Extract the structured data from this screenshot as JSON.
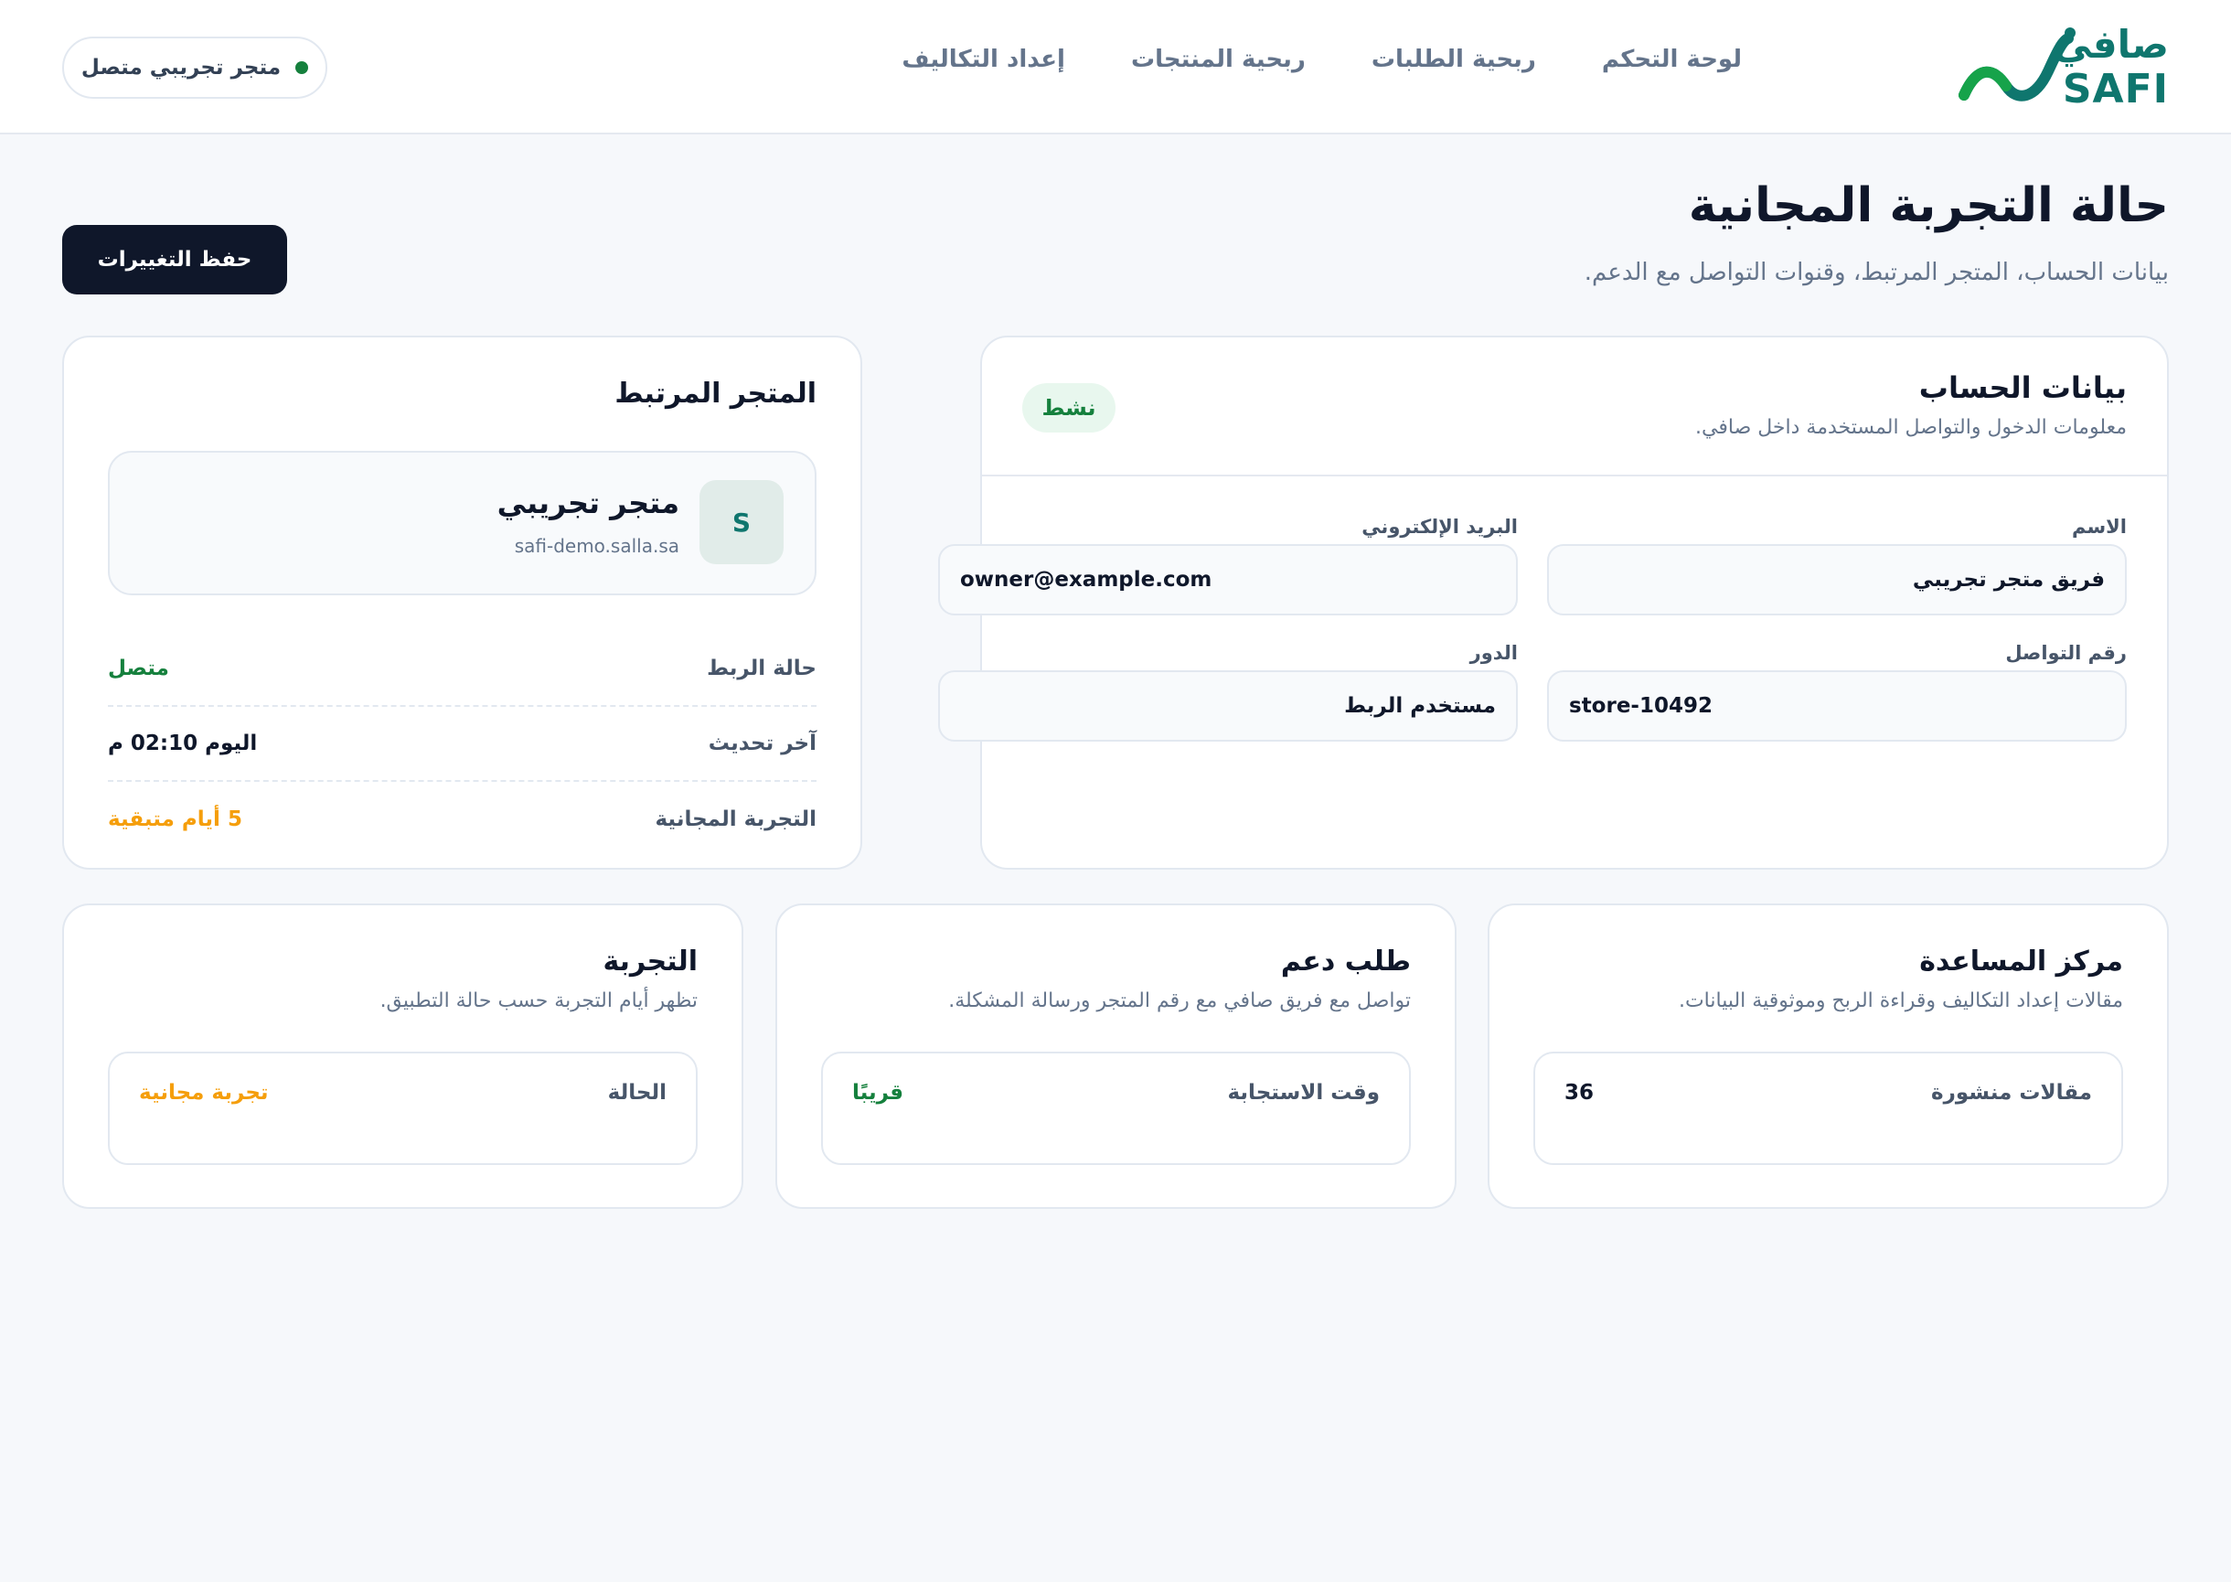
{
  "brand": {
    "name_ar": "صافي",
    "name_en": "SAFI"
  },
  "nav": {
    "items": [
      {
        "label": "لوحة التحكم"
      },
      {
        "label": "ربحية الطلبات"
      },
      {
        "label": "ربحية المنتجات"
      },
      {
        "label": "إعداد التكاليف"
      }
    ]
  },
  "store_status": {
    "label": "متجر تجريبي متصل"
  },
  "page": {
    "title": "حالة التجربة المجانية",
    "subtitle": "بيانات الحساب، المتجر المرتبط، وقنوات التواصل مع الدعم.",
    "save_label": "حفظ التغييرات"
  },
  "account": {
    "title": "بيانات الحساب",
    "description": "معلومات الدخول والتواصل المستخدمة داخل صافي.",
    "badge": "نشط",
    "fields": {
      "name": {
        "label": "الاسم",
        "value": "فريق متجر تجريبي"
      },
      "email": {
        "label": "البريد الإلكتروني",
        "value": "owner@example.com"
      },
      "phone": {
        "label": "رقم التواصل",
        "value": "store-10492"
      },
      "role": {
        "label": "الدور",
        "value": "مستخدم الربط"
      }
    }
  },
  "linked_store": {
    "title": "المتجر المرتبط",
    "avatar": "S",
    "name": "متجر تجريبي",
    "url": "safi-demo.salla.sa",
    "rows": [
      {
        "key": "حالة الربط",
        "value": "متصل"
      },
      {
        "key": "آخر تحديث",
        "value": "اليوم 02:10 م"
      },
      {
        "key": "التجربة المجانية",
        "value": "5 أيام متبقية"
      }
    ]
  },
  "cards": {
    "help": {
      "title": "مركز المساعدة",
      "description": "مقالات إعداد التكاليف وقراءة الربح وموثوقية البيانات.",
      "key": "مقالات منشورة",
      "value": "36"
    },
    "support": {
      "title": "طلب دعم",
      "description": "تواصل مع فريق صافي مع رقم المتجر ورسالة المشكلة.",
      "key": "وقت الاستجابة",
      "value": "قريبًا"
    },
    "trial": {
      "title": "التجربة",
      "description": "تظهر أيام التجربة حسب حالة التطبيق.",
      "key": "الحالة",
      "value": "تجربة مجانية"
    }
  },
  "colors": {
    "brand": "#0f766e",
    "success": "#15803d",
    "warning": "#f59e0b",
    "dark": "#0f172a"
  }
}
